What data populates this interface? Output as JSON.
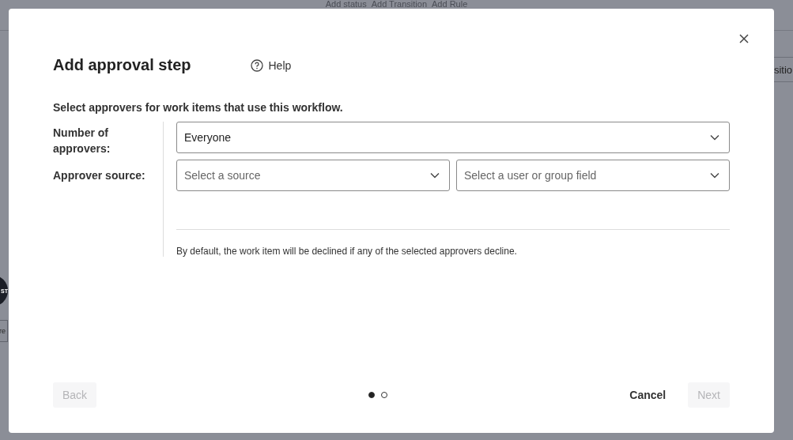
{
  "background": {
    "toolbar_links": [
      "Add status",
      "Add Transition",
      "Add Rule"
    ],
    "right_tab": "sitio",
    "node_label": "ST",
    "node_caption": "re"
  },
  "dialog": {
    "title": "Add approval step",
    "help": "Help",
    "intro": "Select approvers for work items that use this workflow.",
    "fields": [
      {
        "label": "Number of approvers:",
        "selects": [
          {
            "value": "Everyone"
          }
        ]
      },
      {
        "label": "Approver source:",
        "selects": [
          {
            "placeholder": "Select a source"
          },
          {
            "placeholder": "Select a user or group field"
          }
        ]
      }
    ],
    "note": "By default, the work item will be declined if any of the selected approvers decline.",
    "steps": [
      {
        "selected": true
      },
      {
        "selected": false
      }
    ],
    "buttons": {
      "back": {
        "label": "Back",
        "disabled": true
      },
      "cancel": {
        "label": "Cancel",
        "disabled": false
      },
      "next": {
        "label": "Next",
        "disabled": true
      }
    }
  }
}
